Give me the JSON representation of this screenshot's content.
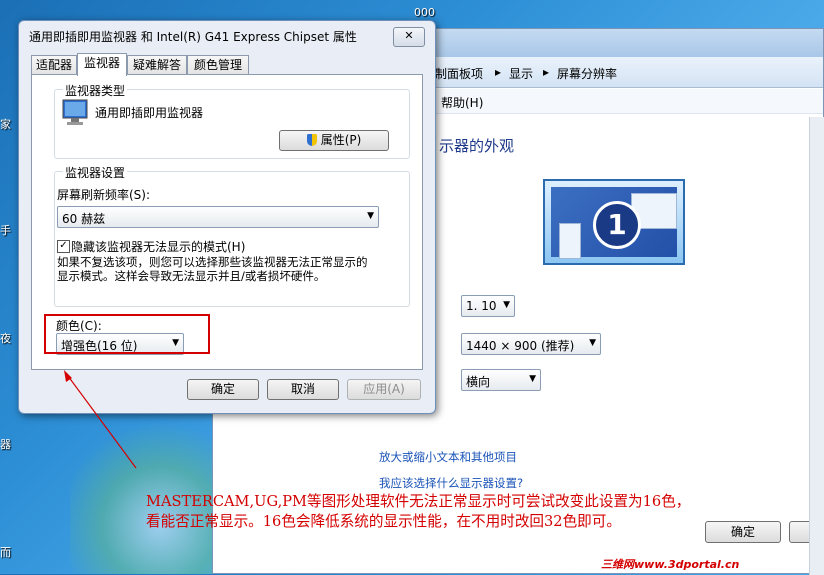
{
  "desktop": {
    "top_label": "000",
    "side_labels": [
      "家",
      "手",
      "夜",
      "器",
      "而"
    ]
  },
  "control_panel": {
    "breadcrumb": [
      "制面板项",
      "显示",
      "屏幕分辨率"
    ],
    "breadcrumb_sep": "▸",
    "menu_help": "帮助(H)",
    "heading": "示器的外观",
    "monitor_number": "1",
    "display_value": "1. 10",
    "resolution_value": "1440 × 900 (推荐)",
    "orientation_value": "横向",
    "link_text_size": "放大或缩小文本和其他项目",
    "link_which_settings": "我应该选择什么显示器设置?",
    "ok_label": "确定"
  },
  "dialog": {
    "title": "通用即插即用监视器 和 Intel(R) G41 Express Chipset 属性",
    "close_glyph": "✕",
    "tabs": [
      "适配器",
      "监视器",
      "疑难解答",
      "颜色管理"
    ],
    "active_tab": 1,
    "monitor_type_group": "监视器类型",
    "monitor_name": "通用即插即用监视器",
    "properties_button": "属性(P)",
    "monitor_settings_group": "监视器设置",
    "refresh_label": "屏幕刷新频率(S):",
    "refresh_value": "60 赫兹",
    "hide_modes_label": "隐藏该监视器无法显示的模式(H)",
    "hide_modes_checked": true,
    "hide_modes_desc_1": "如果不复选该项，则您可以选择那些该监视器无法正常显示的",
    "hide_modes_desc_2": "显示模式。这样会导致无法显示并且/或者损坏硬件。",
    "color_label": "颜色(C):",
    "color_value": "增强色(16 位)",
    "ok_button": "确定",
    "cancel_button": "取消",
    "apply_button": "应用(A)"
  },
  "annotation": {
    "line1": "MASTERCAM,UG,PM等图形处理软件无法正常显示时可尝试改变此设置为16色，",
    "line2": "看能否正常显示。16色会降低系统的显示性能，在不用时改回32色即可。",
    "highlight_color": "#d40000"
  },
  "watermark": "三维网www.3dportal.cn"
}
